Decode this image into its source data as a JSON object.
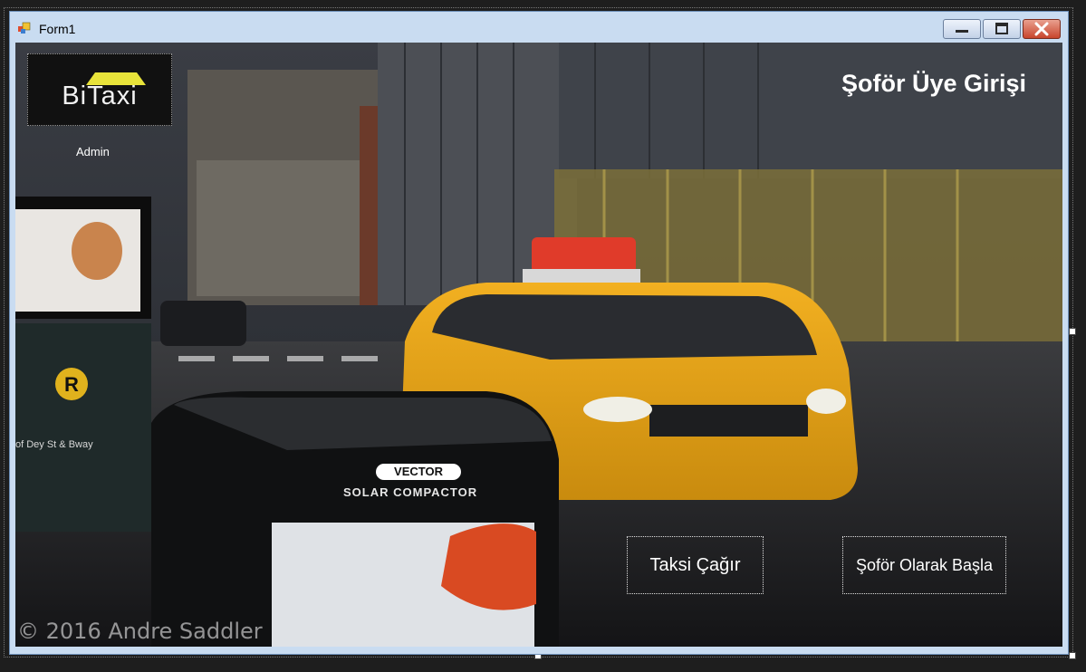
{
  "window": {
    "title": "Form1",
    "controls": {
      "minimize": "minimize-icon",
      "maximize": "maximize-icon",
      "close": "close-icon"
    }
  },
  "logo": {
    "text": "BiTaxi",
    "accent_color": "#e8e33a"
  },
  "user_label": "Admin",
  "heading": "Şoför Üye Girişi",
  "buttons": {
    "call_taxi": "Taksi Çağır",
    "start_driver": "Şoför Olarak Başla"
  },
  "background": {
    "subject": "yellow taxi on city street",
    "copyright": "© 2016 Andre Saddler",
    "billboard_letter": "R",
    "billboard_text": "of Dey St & Bway",
    "compactor_brand": "VECTOR",
    "compactor_label": "SOLAR COMPACTOR"
  }
}
